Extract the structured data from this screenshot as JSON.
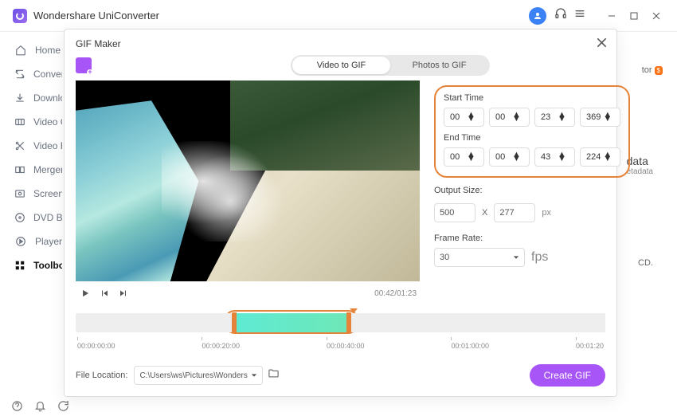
{
  "app": {
    "title": "Wondershare UniConverter",
    "bg_tor": "tor",
    "bg_data": "data",
    "bg_etadata": "etadata",
    "bg_cd": "CD."
  },
  "sidebar": {
    "items": [
      {
        "label": "Home"
      },
      {
        "label": "Converter"
      },
      {
        "label": "Downloader"
      },
      {
        "label": "Video Compressor"
      },
      {
        "label": "Video Editor"
      },
      {
        "label": "Merger"
      },
      {
        "label": "Screen Recorder"
      },
      {
        "label": "DVD Burner"
      },
      {
        "label": "Player"
      },
      {
        "label": "Toolbox"
      }
    ]
  },
  "modal": {
    "title": "GIF Maker",
    "tabs": {
      "video": "Video to GIF",
      "photos": "Photos to GIF"
    },
    "start_label": "Start Time",
    "end_label": "End Time",
    "start": {
      "h": "00",
      "m": "00",
      "s": "23",
      "ms": "369"
    },
    "end": {
      "h": "00",
      "m": "00",
      "s": "43",
      "ms": "224"
    },
    "output_label": "Output Size:",
    "output_w": "500",
    "x": "X",
    "output_h": "277",
    "px": "px",
    "framerate_label": "Frame Rate:",
    "framerate": "30",
    "fps": "fps",
    "time_current": "00:42/01:23",
    "ruler": [
      "00:00:00:00",
      "00:00:20:00",
      "00:00:40:00",
      "00:01:00:00",
      "00:01:20"
    ],
    "loc_label": "File Location:",
    "loc_value": "C:\\Users\\ws\\Pictures\\Wonders",
    "create": "Create GIF"
  }
}
